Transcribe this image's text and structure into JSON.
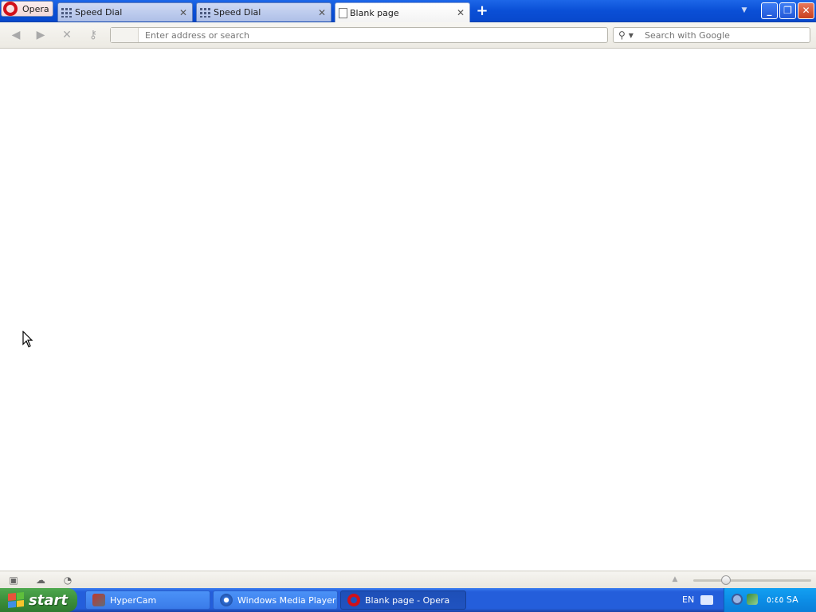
{
  "tabbar": {
    "menu_label": "Opera",
    "tabs": [
      {
        "title": "Speed Dial",
        "icon": "speed-dial-icon",
        "active": false
      },
      {
        "title": "Speed Dial",
        "icon": "speed-dial-icon",
        "active": false
      },
      {
        "title": "Blank page",
        "icon": "page-icon",
        "active": true
      }
    ],
    "new_tab_glyph": "+",
    "close_glyph": "✕"
  },
  "navbar": {
    "address_placeholder": "Enter address or search",
    "address_value": "",
    "search_placeholder": "Search with Google",
    "search_value": ""
  },
  "taskbar": {
    "start_label": "start",
    "items": [
      {
        "label": "HyperCam",
        "icon": "hypercam-icon",
        "active": false
      },
      {
        "label": "Windows Media Player",
        "icon": "windows-media-player-icon",
        "active": false
      },
      {
        "label": "Blank page - Opera",
        "icon": "opera-icon",
        "active": true
      }
    ],
    "language": "EN",
    "clock": "٥:٤٥ SA"
  },
  "colors": {
    "opera_red": "#d1111a",
    "taskbar_blue": "#245edb",
    "start_green": "#3c8f3c",
    "tray_blue": "#0c8ee6"
  }
}
